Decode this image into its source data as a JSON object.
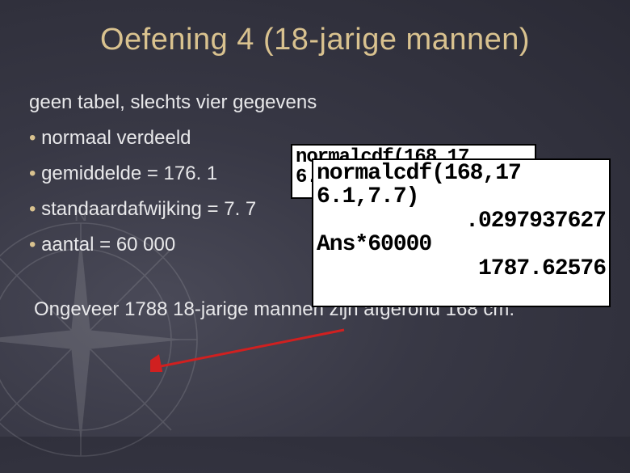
{
  "title": "Oefening 4 (18-jarige mannen)",
  "subtitle": "geen tabel, slechts vier gegevens",
  "bullets": [
    "normaal verdeeld",
    "gemiddelde = 176. 1",
    "standaardafwijking = 7. 7",
    "aantal = 60 000"
  ],
  "conclusion": "Ongeveer 1788 18-jarige mannen zijn afgerond 168 cm.",
  "calculator_back": {
    "line1": "normalcdf(168,17",
    "line2": "6."
  },
  "calculator_front": {
    "line1": "normalcdf(168,17",
    "line2": "6.1,7.7)",
    "result1": ".0297937627",
    "line3": "Ans*60000",
    "result2": "1787.62576"
  },
  "colors": {
    "title": "#d9c28f",
    "text": "#e8e8ea",
    "background": "#3a3a4a",
    "arrow": "#d02020"
  }
}
